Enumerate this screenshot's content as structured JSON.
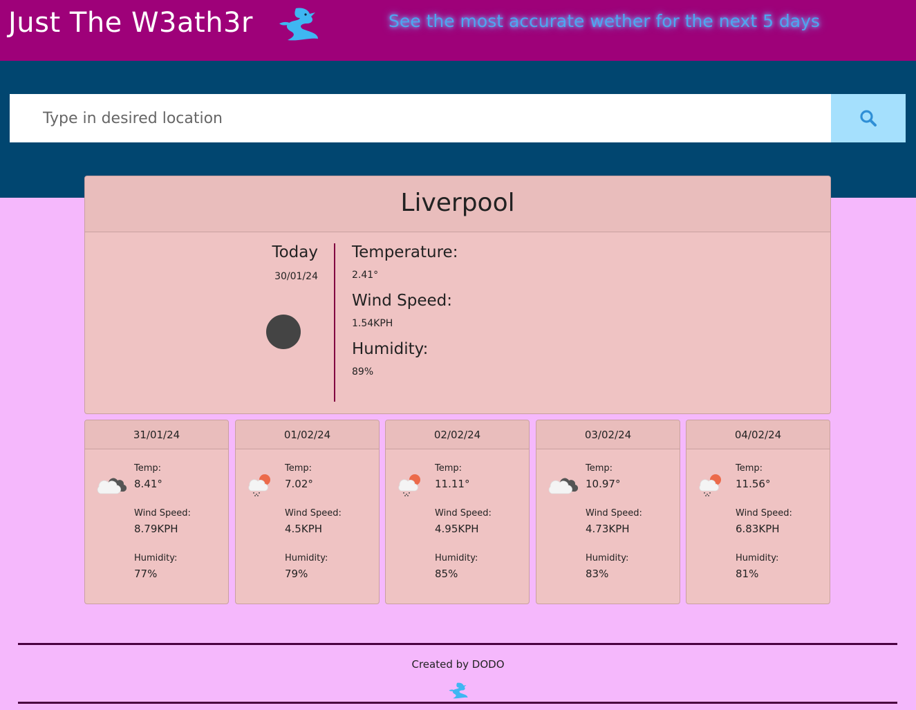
{
  "header": {
    "title": "Just The W3ath3r",
    "tagline": "See the most accurate wether for the next 5 days",
    "logo_icon": "dragon-logo-icon"
  },
  "search": {
    "placeholder": "Type in desired location",
    "value": "",
    "button_icon": "search-icon"
  },
  "today": {
    "city": "Liverpool",
    "label": "Today",
    "date": "30/01/24",
    "icon": "night-moon-icon",
    "temperature_label": "Temperature:",
    "temperature": "2.41°",
    "wind_label": "Wind Speed:",
    "wind": "1.54KPH",
    "humidity_label": "Humidity:",
    "humidity": "89%"
  },
  "forecast": [
    {
      "date": "31/01/24",
      "icon": "cloudy-icon",
      "temp_label": "Temp:",
      "temp": "8.41°",
      "wind_label": "Wind Speed:",
      "wind": "8.79KPH",
      "humidity_label": "Humidity:",
      "humidity": "77%"
    },
    {
      "date": "01/02/24",
      "icon": "sun-rain-cloud-icon",
      "temp_label": "Temp:",
      "temp": "7.02°",
      "wind_label": "Wind Speed:",
      "wind": "4.5KPH",
      "humidity_label": "Humidity:",
      "humidity": "79%"
    },
    {
      "date": "02/02/24",
      "icon": "sun-rain-cloud-icon",
      "temp_label": "Temp:",
      "temp": "11.11°",
      "wind_label": "Wind Speed:",
      "wind": "4.95KPH",
      "humidity_label": "Humidity:",
      "humidity": "85%"
    },
    {
      "date": "03/02/24",
      "icon": "cloudy-icon",
      "temp_label": "Temp:",
      "temp": "10.97°",
      "wind_label": "Wind Speed:",
      "wind": "4.73KPH",
      "humidity_label": "Humidity:",
      "humidity": "83%"
    },
    {
      "date": "04/02/24",
      "icon": "sun-rain-cloud-icon",
      "temp_label": "Temp:",
      "temp": "11.56°",
      "wind_label": "Wind Speed:",
      "wind": "6.83KPH",
      "humidity_label": "Humidity:",
      "humidity": "81%"
    }
  ],
  "footer": {
    "credit": "Created by DODO",
    "logo_icon": "dragon-logo-icon"
  },
  "colors": {
    "header_bg": "#9e0179",
    "search_band_bg": "#014670",
    "page_bg": "#f5b8fc",
    "card_bg": "#efc3c3",
    "search_button_bg": "#a5e0fd",
    "tagline": "#4ea6f0",
    "accent_blue": "#3fb6f2"
  }
}
